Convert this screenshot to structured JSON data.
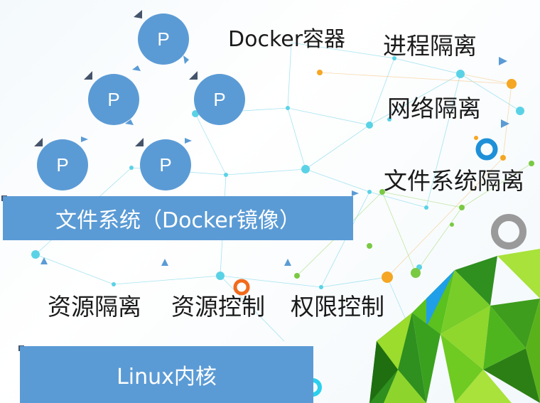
{
  "title": "Docker容器",
  "process_label": "P",
  "isolation": {
    "process": "进程隔离",
    "network": "网络隔离",
    "filesystem": "文件系统隔离"
  },
  "filesystem_bar": "文件系统（Docker镜像）",
  "controls": {
    "resource_isolation": "资源隔离",
    "resource_control": "资源控制",
    "permission_control": "权限控制"
  },
  "kernel_bar": "Linux内核",
  "colors": {
    "bar": "#5b9bd5",
    "process": "#5b9bd5",
    "network_line": "#5ad2e6",
    "accent_orange": "#f5a623",
    "accent_green": "#7ac943"
  }
}
